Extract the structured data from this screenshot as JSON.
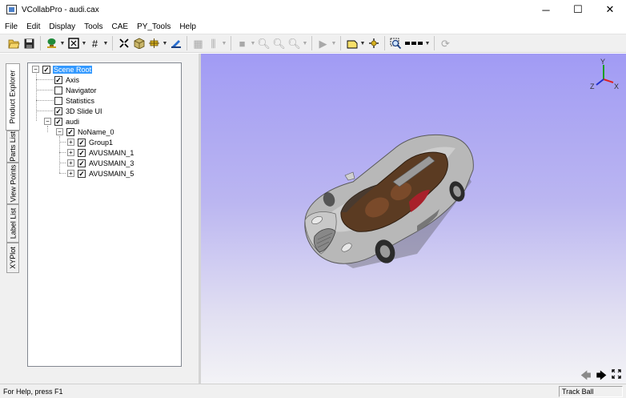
{
  "window": {
    "title": "VCollabPro - audi.cax",
    "minimize": "─",
    "maximize": "☐",
    "close": "✕"
  },
  "menu": [
    "File",
    "Edit",
    "Display",
    "Tools",
    "CAE",
    "PY_Tools",
    "Help"
  ],
  "side_tabs": [
    "Product Explorer",
    "Parts List",
    "View Points",
    "Label List",
    "XYPlot"
  ],
  "tree": {
    "root": "Scene Root",
    "axis": "Axis",
    "navigator": "Navigator",
    "statistics": "Statistics",
    "slide": "3D Slide UI",
    "audi": "audi",
    "noname": "NoName_0",
    "group1": "Group1",
    "avus1": "AVUSMAIN_1",
    "avus3": "AVUSMAIN_3",
    "avus5": "AVUSMAIN_5",
    "expand_plus": "+",
    "expand_minus": "−",
    "check": "✓"
  },
  "axis_labels": {
    "x": "X",
    "y": "Y",
    "z": "Z"
  },
  "status": {
    "help_text": "For Help, press F1",
    "mode": "Track Ball"
  },
  "colors": {
    "viewport_top": "#a19bf4",
    "viewport_bottom": "#f3f3f6",
    "selection": "#3399ff",
    "axis_x": "#e02020",
    "axis_y": "#1aa01a",
    "axis_z": "#2030d0"
  }
}
